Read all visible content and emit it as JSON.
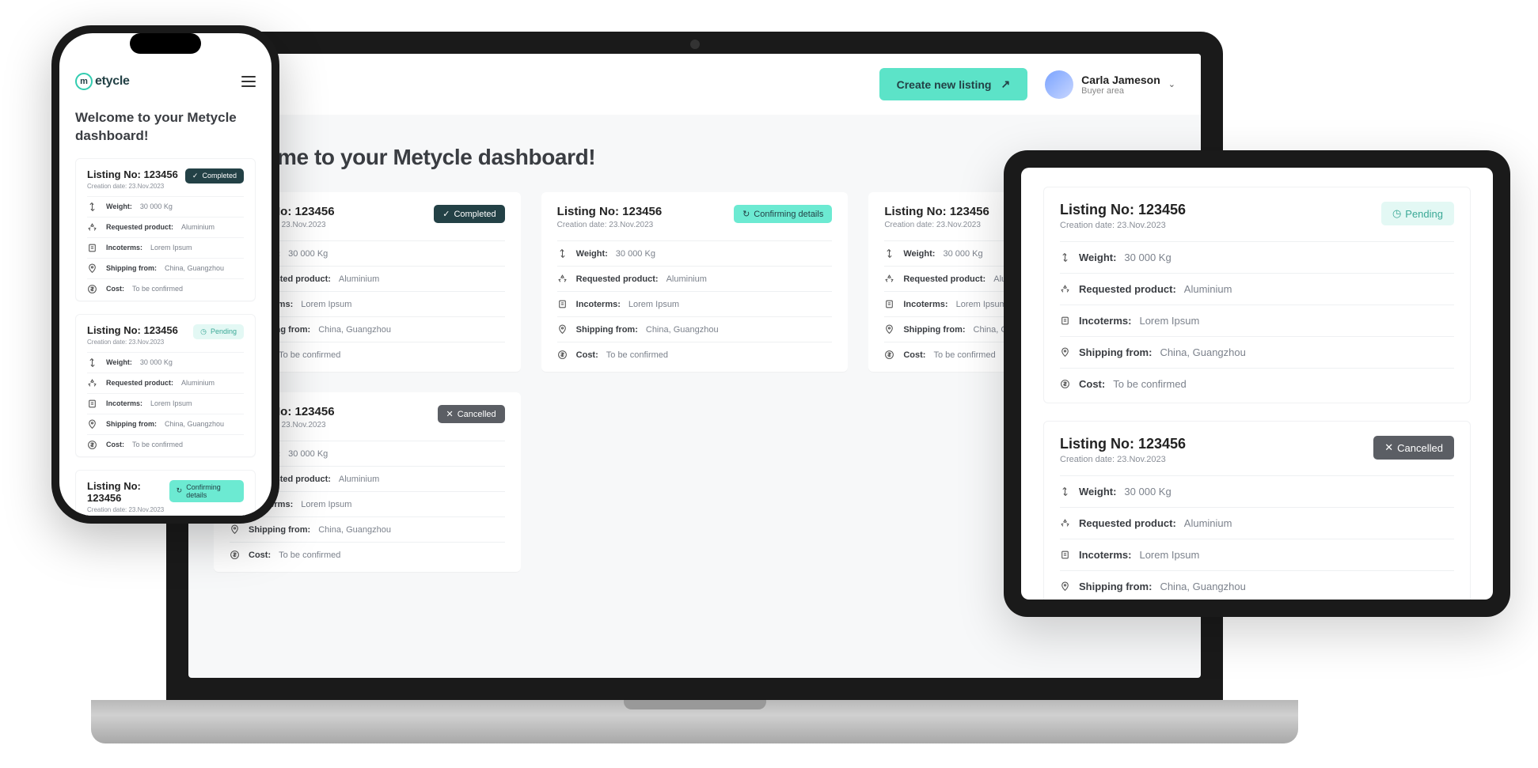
{
  "brand": {
    "name": "etycle",
    "mark": "m"
  },
  "header": {
    "create_label": "Create new listing",
    "user": {
      "name": "Carla Jameson",
      "role": "Buyer area"
    }
  },
  "dash_title": "Welcome to your Metycle dashboard!",
  "status_labels": {
    "completed": "Completed",
    "confirming": "Confirming details",
    "pending": "Pending",
    "cancelled": "Cancelled"
  },
  "field_labels": {
    "weight": "Weight:",
    "requested": "Requested product:",
    "incoterms": "Incoterms:",
    "shipping": "Shipping from:",
    "cost": "Cost:"
  },
  "listing_shared": {
    "title": "Listing No: 123456",
    "created": "Creation date: 23.Nov.2023",
    "weight": "30 000 Kg",
    "requested": "Aluminium",
    "incoterms": "Lorem Ipsum",
    "shipping": "China, Guangzhou",
    "cost": "To be confirmed"
  },
  "laptop_listings": [
    {
      "status": "completed"
    },
    {
      "status": "confirming"
    },
    {
      "status": "pending"
    },
    {
      "status": "cancelled"
    }
  ],
  "phone_listings": [
    {
      "status": "completed"
    },
    {
      "status": "pending"
    },
    {
      "status": "confirming"
    }
  ],
  "tablet_listings": [
    {
      "status": "pending"
    },
    {
      "status": "cancelled"
    }
  ]
}
